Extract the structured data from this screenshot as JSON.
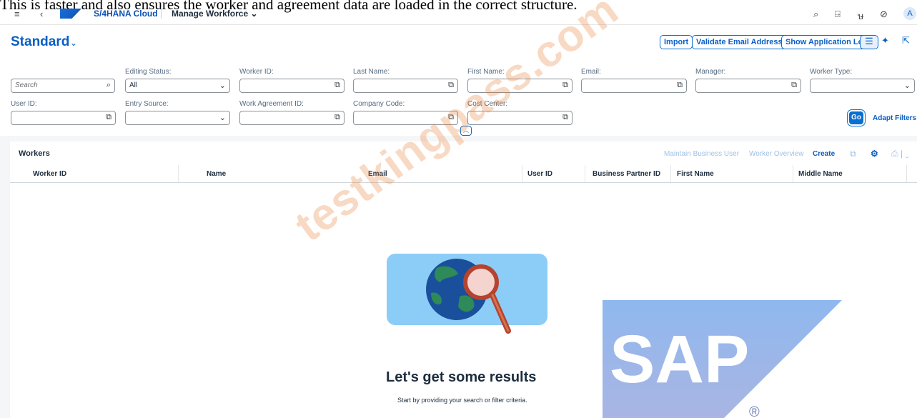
{
  "caption": "This is faster and also ensures the worker and agreement data are loaded in the correct structure.",
  "shell": {
    "product_name": "S/4HANA Cloud",
    "app_title": "Manage Workforce",
    "avatar_initial": "A"
  },
  "header": {
    "variant_title": "Standard",
    "buttons": {
      "import": "Import",
      "validate_email": "Validate Email Addresses",
      "show_log": "Show Application Log"
    }
  },
  "filters": {
    "search_placeholder": "Search",
    "editing_status": {
      "label": "Editing Status:",
      "value": "All"
    },
    "worker_id": {
      "label": "Worker ID:",
      "value": ""
    },
    "last_name": {
      "label": "Last Name:",
      "value": ""
    },
    "first_name": {
      "label": "First Name:",
      "value": ""
    },
    "email": {
      "label": "Email:",
      "value": ""
    },
    "manager": {
      "label": "Manager:",
      "value": ""
    },
    "worker_type": {
      "label": "Worker Type:",
      "value": ""
    },
    "user_id": {
      "label": "User ID:",
      "value": ""
    },
    "entry_source": {
      "label": "Entry Source:",
      "value": ""
    },
    "work_agreement_id": {
      "label": "Work Agreement ID:",
      "value": ""
    },
    "company_code": {
      "label": "Company Code:",
      "value": ""
    },
    "cost_center": {
      "label": "Cost Center:",
      "value": ""
    },
    "go_label": "Go",
    "adapt_filters_label": "Adapt Filters"
  },
  "table": {
    "title": "Workers",
    "toolbar": {
      "maintain_business_user": "Maintain Business User",
      "worker_overview": "Worker Overview",
      "create": "Create"
    },
    "columns": [
      "Worker ID",
      "Name",
      "Email",
      "User ID",
      "Business Partner ID",
      "First Name",
      "Middle Name"
    ]
  },
  "empty_state": {
    "title": "Let's get some results",
    "subtitle": "Start by providing your search or filter criteria."
  },
  "watermark_text": "testkingpass.com",
  "sap_logo": {
    "text": "SAP",
    "registered": "®"
  },
  "colors": {
    "brand_blue": "#0a6ed1",
    "link_blue": "#0a5fc4",
    "illustration_bg": "#8ccdf7",
    "watermark": "#e67828"
  }
}
